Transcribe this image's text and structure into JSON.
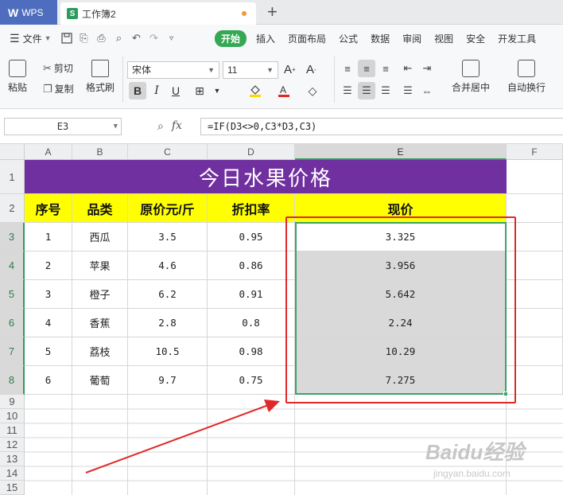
{
  "tabs": {
    "app_label": "WPS",
    "doc_label": "工作簿2",
    "new_tab": "+"
  },
  "menu": {
    "file_label": "文件",
    "items": [
      "开始",
      "插入",
      "页面布局",
      "公式",
      "数据",
      "审阅",
      "视图",
      "安全",
      "开发工具"
    ],
    "active_index": 0
  },
  "ribbon": {
    "paste": "粘贴",
    "cut": "剪切",
    "copy": "复制",
    "format_painter": "格式刷",
    "font_name": "宋体",
    "font_size": "11",
    "bold": "B",
    "italic": "I",
    "underline": "U",
    "merge_center": "合并居中",
    "wrap_text": "自动换行"
  },
  "formula_bar": {
    "name_box": "E3",
    "fx": "fx",
    "formula": "=IF(D3<>0,C3*D3,C3)"
  },
  "sheet": {
    "columns": [
      "A",
      "B",
      "C",
      "D",
      "E",
      "F"
    ],
    "selected_column": "E",
    "rows": [
      "1",
      "2",
      "3",
      "4",
      "5",
      "6",
      "7",
      "8",
      "9",
      "10",
      "11",
      "12",
      "13",
      "14",
      "15"
    ],
    "title": "今日水果价格",
    "headers": [
      "序号",
      "品类",
      "原价元/斤",
      "折扣率",
      "现价"
    ],
    "data": [
      [
        "1",
        "西瓜",
        "3.5",
        "0.95",
        "3.325"
      ],
      [
        "2",
        "苹果",
        "4.6",
        "0.86",
        "3.956"
      ],
      [
        "3",
        "橙子",
        "6.2",
        "0.91",
        "5.642"
      ],
      [
        "4",
        "香蕉",
        "2.8",
        "0.8",
        "2.24"
      ],
      [
        "5",
        "荔枝",
        "10.5",
        "0.98",
        "10.29"
      ],
      [
        "6",
        "葡萄",
        "9.7",
        "0.75",
        "7.275"
      ]
    ]
  },
  "colors": {
    "title_bg": "#7030a0",
    "header_bg": "#ffff00",
    "selection": "#3aa36a",
    "annotation": "#e02828",
    "accent": "#34a853"
  },
  "watermark": {
    "main": "Baidu经验",
    "sub": "jingyan.baidu.com"
  }
}
